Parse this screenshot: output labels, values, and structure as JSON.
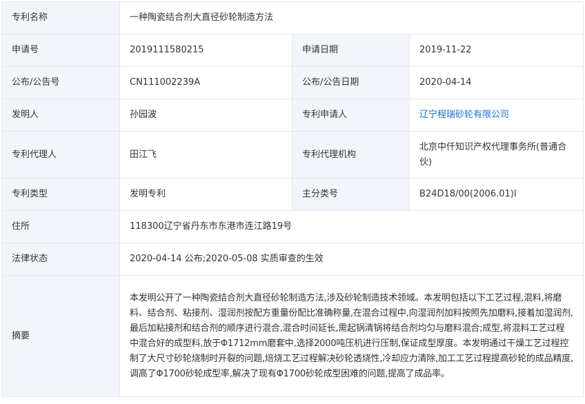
{
  "labels": {
    "patent_name": "专利名称",
    "application_no": "申请号",
    "application_date": "申请日期",
    "publication_no": "公布/公告号",
    "publication_date": "公布/公告日期",
    "inventor": "发明人",
    "applicant": "专利申请人",
    "agent": "专利代理人",
    "agency": "专利代理机构",
    "patent_type": "专利类型",
    "main_class": "主分类号",
    "address": "住所",
    "legal_status": "法律状态",
    "abstract": "摘要"
  },
  "values": {
    "patent_name": "一种陶瓷结合剂大直径砂轮制造方法",
    "application_no": "2019111580215",
    "application_date": "2019-11-22",
    "publication_no": "CN111002239A",
    "publication_date": "2020-04-14",
    "inventor": "孙园波",
    "applicant": "辽宁程瑞砂轮有限公司",
    "agent": "田江飞",
    "agency": "北京中仟知识产权代理事务所(普通合伙)",
    "patent_type": "发明专利",
    "main_class": "B24D18/00(2006.01)I",
    "address": "118300辽宁省丹东市东港市连江路19号",
    "legal_status": "2020-04-14 公布;2020-05-08 实质审查的生效",
    "abstract": "本发明公开了一种陶瓷结合剂大直径砂轮制造方法,涉及砂轮制造技术领域。本发明包括以下工艺过程,混料,将磨料、结合剂、粘接剂、湿润剂按配方重量份配比准确称量,在混合过程中,向湿润剂加料按照先加磨料,接着加湿润剂,最后加粘接剂和结合剂的顺序进行混合,混合时间延长,需起锅清锅将结合剂均匀与磨料混合;成型,将混料工艺过程中混合好的成型料,放于Φ1712mm磨套中,选择2000吨压机进行压制,保证成型厚度。本发明通过干燥工艺过程控制了大尺寸砂轮烧制时开裂的问题,焙烧工艺过程解决砂轮透烧性,冷却应力清除,加工工艺过程提高砂轮的成品精度,调高了Φ1700砂轮成型率,解决了现有Φ1700砂轮成型困难的问题,提高了成品率。"
  },
  "colors": {
    "label_bg": "#f2f6fb",
    "border": "#e3e8ef",
    "link": "#1a6fd6",
    "text": "#333333"
  }
}
